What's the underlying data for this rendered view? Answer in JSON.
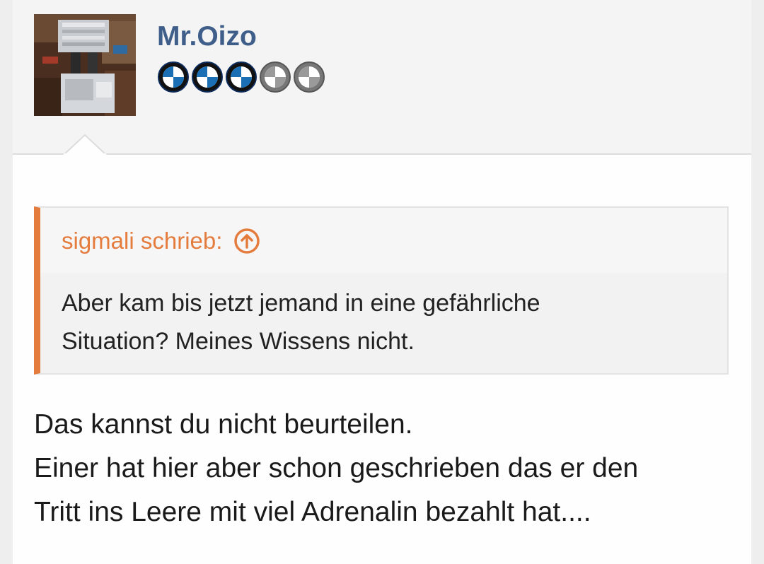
{
  "post": {
    "author": {
      "name": "Mr.Oizo",
      "avatar": "engine-photo-avatar",
      "rank": {
        "filled": 3,
        "total": 5,
        "icon": "bmw-roundel-icon"
      }
    },
    "quote": {
      "header": "sigmali schrieb:",
      "jump_icon": "arrow-up-circle-icon",
      "lines": [
        "Aber kam bis jetzt jemand in eine gefährliche",
        "Situation? Meines Wissens nicht."
      ]
    },
    "message": {
      "lines": [
        "Das kannst du nicht beurteilen.",
        "Einer hat hier aber schon geschrieben das er den",
        "Tritt ins Leere mit viel Adrenalin bezahlt hat...."
      ]
    }
  },
  "colors": {
    "username": "#3f5f8a",
    "quote_accent": "#e47c3e",
    "roundel_blue": "#1a6fb5",
    "roundel_grey": "#9a9a9a"
  }
}
